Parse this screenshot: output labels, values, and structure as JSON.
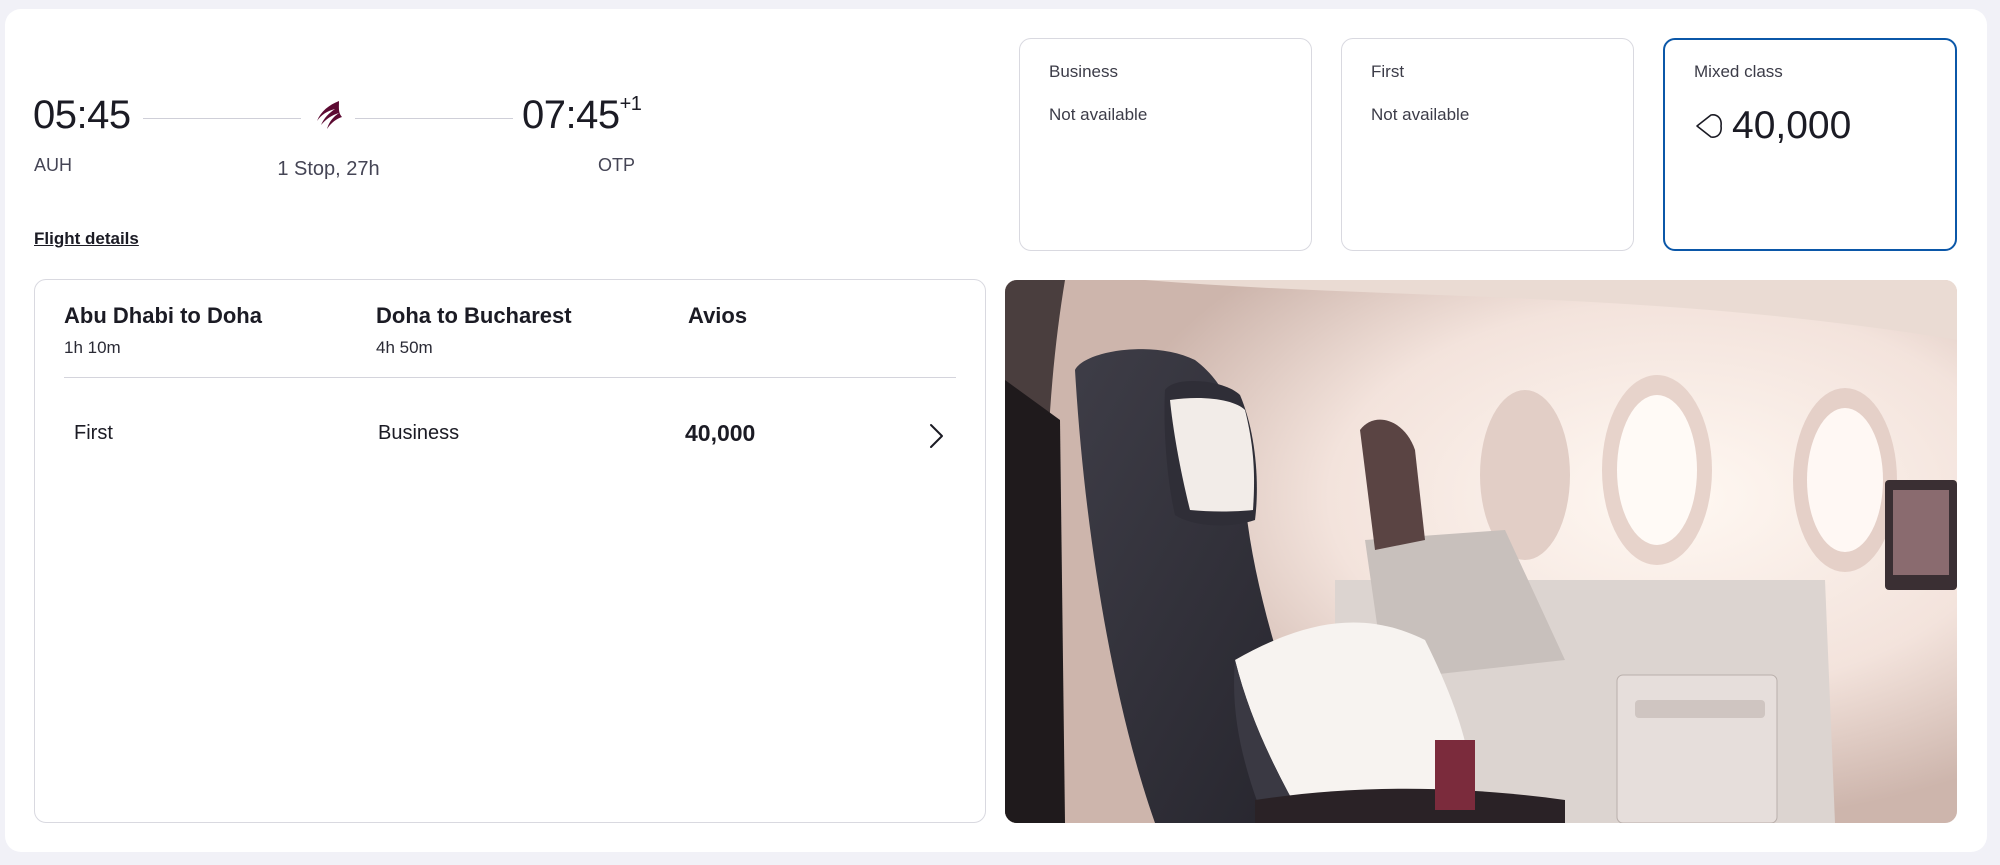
{
  "flight": {
    "departure_time": "05:45",
    "arrival_time": "07:45",
    "arrival_day_offset": "+1",
    "origin_code": "AUH",
    "destination_code": "OTP",
    "stops_duration": "1 Stop, 27h",
    "details_link": "Flight details",
    "airline_logo": "qatar-oryx-logo"
  },
  "cabins": [
    {
      "name": "Business",
      "status": "Not available"
    },
    {
      "name": "First",
      "status": "Not available"
    },
    {
      "name": "Mixed class",
      "price": "40,000",
      "icon": "avios-icon",
      "selected": true
    }
  ],
  "breakdown": {
    "headers": [
      {
        "title": "Abu Dhabi to Doha",
        "duration": "1h 10m"
      },
      {
        "title": "Doha to Bucharest",
        "duration": "4h 50m"
      },
      {
        "title": "Avios"
      }
    ],
    "row": {
      "segment1_class": "First",
      "segment2_class": "Business",
      "avios": "40,000"
    }
  },
  "colors": {
    "selected_border": "#0b57a8",
    "brand": "#5c0a32",
    "page_bg": "#f1f1f7"
  }
}
